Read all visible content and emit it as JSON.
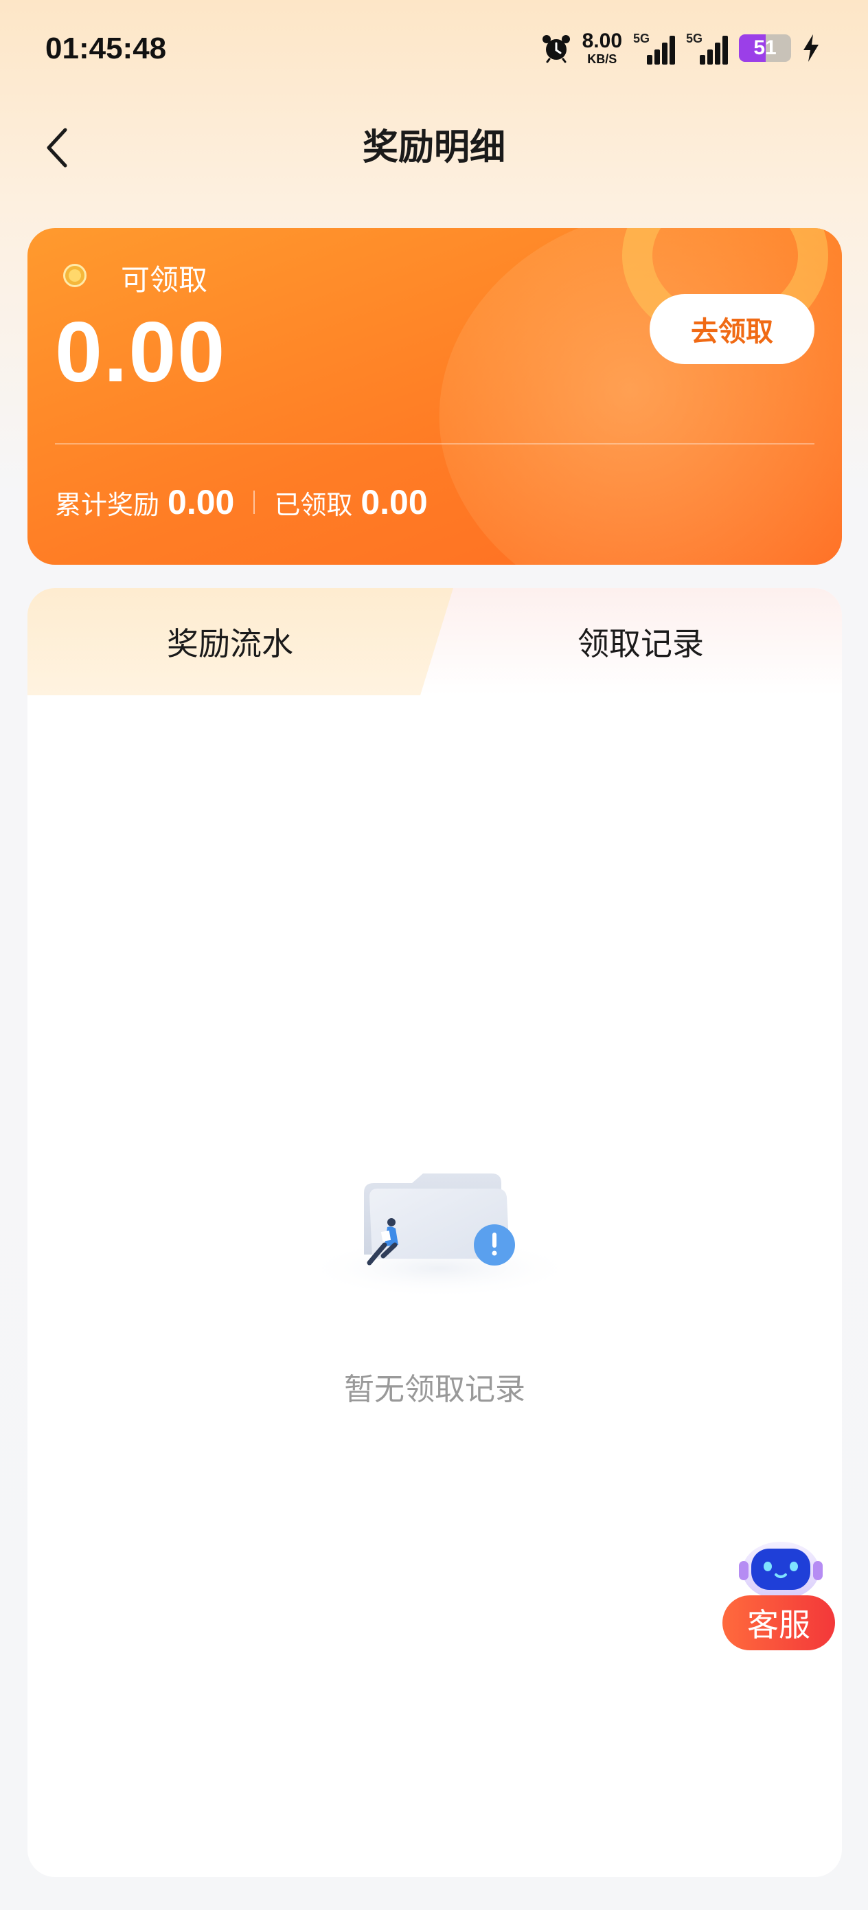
{
  "status_bar": {
    "time": "01:45:48",
    "net_speed_value": "8.00",
    "net_speed_unit": "KB/S",
    "signal_1_gen": "5G",
    "signal_2_gen": "5G",
    "battery_level": "51",
    "icons": [
      "alarm-icon",
      "signal-icon",
      "battery-icon",
      "charging-bolt-icon"
    ]
  },
  "nav": {
    "title": "奖励明细",
    "back_icon": "chevron-left-icon"
  },
  "reward_card": {
    "claimable_label": "可领取",
    "claimable_amount": "0.00",
    "claim_button": "去领取",
    "total_label": "累计奖励",
    "total_value": "0.00",
    "claimed_label": "已领取",
    "claimed_value": "0.00",
    "colors": {
      "card": "#ff7d25",
      "button_text": "#f06a14"
    }
  },
  "tabs": [
    {
      "label": "奖励流水",
      "active": true
    },
    {
      "label": "领取记录",
      "active": false
    }
  ],
  "empty_state": {
    "text": "暂无领取记录",
    "icon": "empty-folder-illustration"
  },
  "service": {
    "label": "客服",
    "icon": "robot-icon"
  }
}
